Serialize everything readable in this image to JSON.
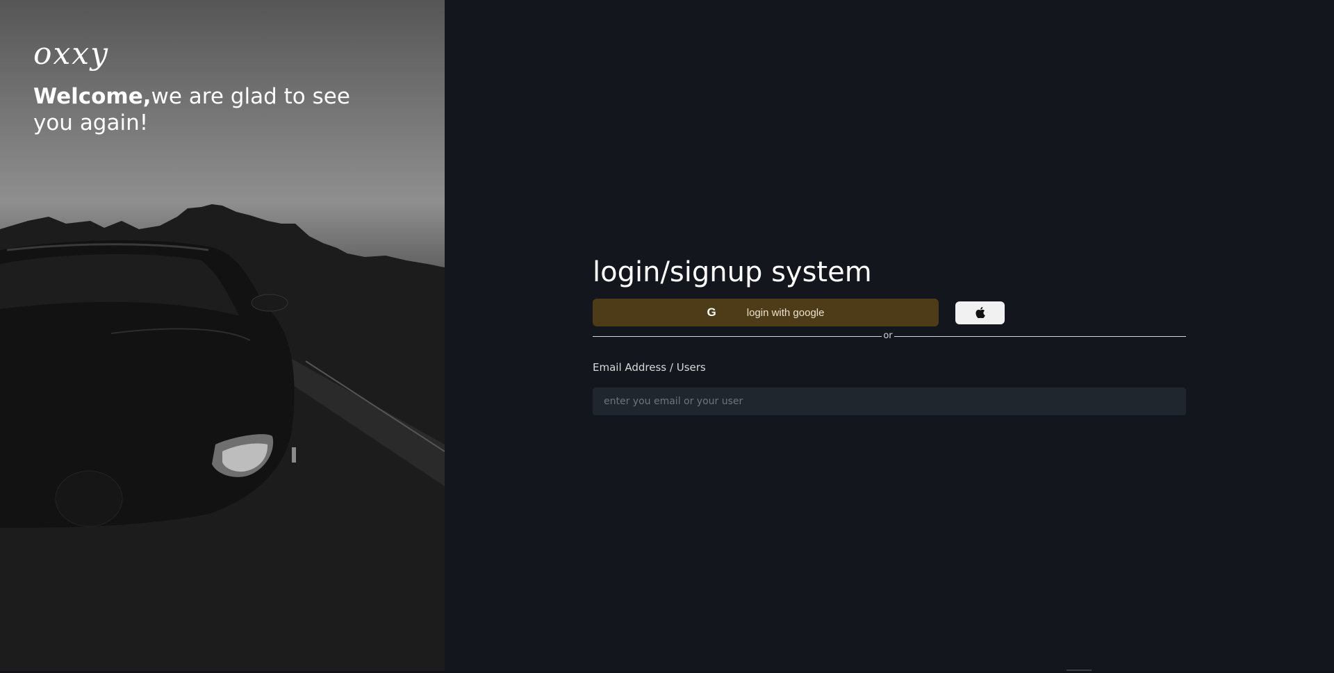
{
  "hero": {
    "brand": "oxxy",
    "welcome_bold": "Welcome,",
    "welcome_rest": "we are glad to see you again!"
  },
  "login": {
    "title": "login/signup system",
    "google_label": "login with google",
    "google_icon": "G",
    "apple_icon": "apple-icon",
    "divider_text": "or",
    "email_label": "Email Address / Users",
    "email_placeholder": "enter you email or your user",
    "email_value": ""
  },
  "colors": {
    "background": "#13171d",
    "google_button": "#4d3c17",
    "apple_button": "#f1f1f1",
    "input_background": "#1f262e"
  }
}
